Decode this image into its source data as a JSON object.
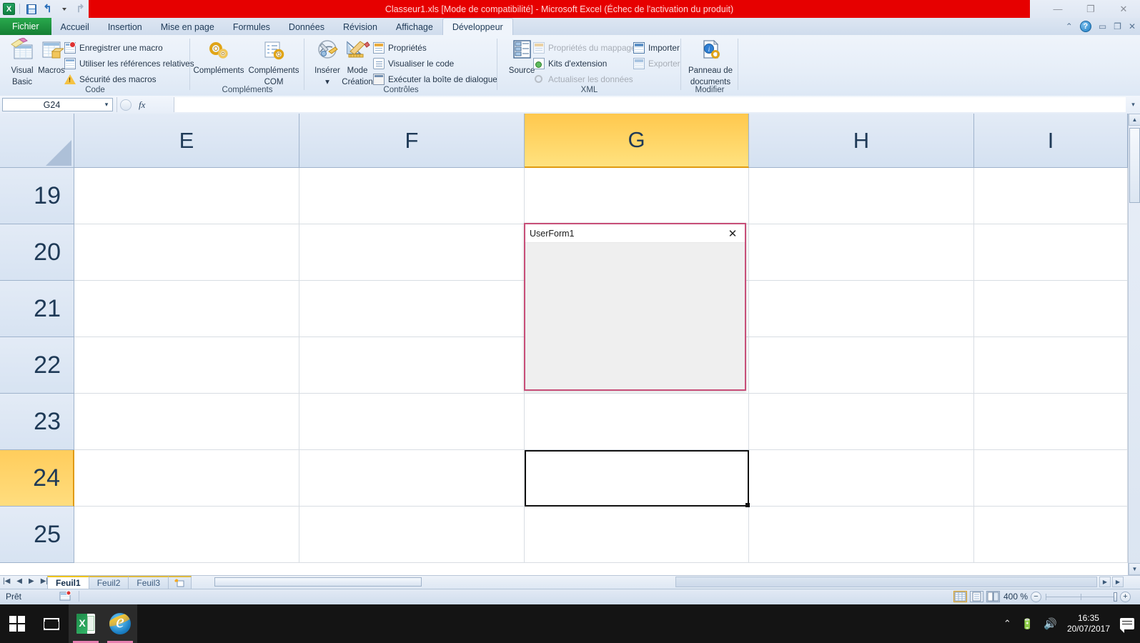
{
  "window": {
    "title": "Classeur1.xls  [Mode de compatibilité]  -  Microsoft Excel (Échec de l'activation du produit)",
    "minimize": "—",
    "restore": "❐",
    "close": "✕"
  },
  "quick_access": {
    "app_icon_letter": "X",
    "save": "save-icon",
    "undo": "↺",
    "redo": "↻",
    "customize": "▾"
  },
  "ribbon": {
    "tabs": [
      {
        "label": "Fichier",
        "active": false,
        "file": true
      },
      {
        "label": "Accueil",
        "active": false
      },
      {
        "label": "Insertion",
        "active": false
      },
      {
        "label": "Mise en page",
        "active": false
      },
      {
        "label": "Formules",
        "active": false
      },
      {
        "label": "Données",
        "active": false
      },
      {
        "label": "Révision",
        "active": false
      },
      {
        "label": "Affichage",
        "active": false
      },
      {
        "label": "Développeur",
        "active": true
      }
    ],
    "help": {
      "minimize_ribbon": "⌃",
      "help": "?",
      "win_min": "▭",
      "win_restore": "❐",
      "win_close": "✕"
    },
    "groups": [
      {
        "name": "Code",
        "big_buttons": [
          {
            "label_line1": "Visual",
            "label_line2": "Basic"
          },
          {
            "label_line1": "Macros",
            "label_line2": ""
          }
        ],
        "small_buttons": [
          {
            "label": "Enregistrer une macro",
            "disabled": false
          },
          {
            "label": "Utiliser les références relatives",
            "disabled": false
          },
          {
            "label": "Sécurité des macros",
            "disabled": false
          }
        ]
      },
      {
        "name": "Compléments",
        "big_buttons": [
          {
            "label_line1": "Compléments",
            "label_line2": ""
          },
          {
            "label_line1": "Compléments",
            "label_line2": "COM"
          }
        ],
        "small_buttons": []
      },
      {
        "name": "Contrôles",
        "big_buttons": [
          {
            "label_line1": "Insérer",
            "label_line2": "▾"
          },
          {
            "label_line1": "Mode",
            "label_line2": "Création"
          }
        ],
        "small_buttons": [
          {
            "label": "Propriétés",
            "disabled": false
          },
          {
            "label": "Visualiser le code",
            "disabled": false
          },
          {
            "label": "Exécuter la boîte de dialogue",
            "disabled": false
          }
        ]
      },
      {
        "name": "XML",
        "big_buttons": [
          {
            "label_line1": "Source",
            "label_line2": ""
          }
        ],
        "small_buttons": [
          {
            "label": "Propriétés du mappage",
            "disabled": true
          },
          {
            "label": "Kits d'extension",
            "disabled": false
          },
          {
            "label": "Actualiser les données",
            "disabled": true
          },
          {
            "label": "Importer",
            "disabled": false
          },
          {
            "label": "Exporter",
            "disabled": true
          }
        ]
      },
      {
        "name": "Modifier",
        "big_buttons": [
          {
            "label_line1": "Panneau de",
            "label_line2": "documents"
          }
        ],
        "small_buttons": []
      }
    ]
  },
  "formula_bar": {
    "name_box_value": "G24",
    "name_box_arrow": "▾",
    "fx_label": "fx",
    "formula_value": "",
    "expand_arrow": "▾"
  },
  "grid": {
    "columns": [
      {
        "label": "E",
        "selected": false
      },
      {
        "label": "F",
        "selected": false
      },
      {
        "label": "G",
        "selected": true
      },
      {
        "label": "H",
        "selected": false
      },
      {
        "label": "I",
        "selected": false
      }
    ],
    "rows": [
      {
        "label": "19",
        "selected": false
      },
      {
        "label": "20",
        "selected": false
      },
      {
        "label": "21",
        "selected": false
      },
      {
        "label": "22",
        "selected": false
      },
      {
        "label": "23",
        "selected": false
      },
      {
        "label": "24",
        "selected": true
      },
      {
        "label": "25",
        "selected": false
      }
    ],
    "active_cell": "G24",
    "cell_values": []
  },
  "userform": {
    "title": "UserForm1",
    "close_glyph": "✕",
    "body_text": ""
  },
  "sheet_tabs": {
    "nav": {
      "first": "|◀",
      "prev": "◀",
      "next": "▶",
      "last": "▶|"
    },
    "tabs": [
      {
        "label": "Feuil1",
        "active": true
      },
      {
        "label": "Feuil2",
        "active": false
      },
      {
        "label": "Feuil3",
        "active": false
      }
    ],
    "new_sheet_icon": "new-sheet-icon"
  },
  "scrollbars": {
    "h_left_arrow": "◀",
    "h_right_arrow": "▶",
    "v_up_arrow": "▲",
    "v_down_arrow": "▼"
  },
  "status_bar": {
    "state": "Prêt",
    "macro_record_icon": "record-macro-icon",
    "views": [
      {
        "name": "normal-view",
        "active": true
      },
      {
        "name": "page-layout-view",
        "active": false
      },
      {
        "name": "page-break-view",
        "active": false
      }
    ],
    "zoom_level": "400 %",
    "zoom_minus": "−",
    "zoom_plus": "+"
  },
  "taskbar": {
    "start_icon": "windows-start-icon",
    "task_view_icon": "task-view-icon",
    "apps": [
      {
        "name": "excel-taskbar-icon",
        "active": true
      },
      {
        "name": "internet-explorer-taskbar-icon",
        "active": true
      }
    ],
    "tray": {
      "chevron": "⌃",
      "battery_icon": "battery-icon",
      "volume_icon": "volume-icon",
      "time": "16:35",
      "date": "20/07/2017",
      "action_center_icon": "action-center-icon"
    }
  },
  "colors": {
    "title_bar_red": "#e60000",
    "selection_yellow": "#ffc84d",
    "userform_border": "#c74e78",
    "file_tab_green": "#157f34"
  }
}
